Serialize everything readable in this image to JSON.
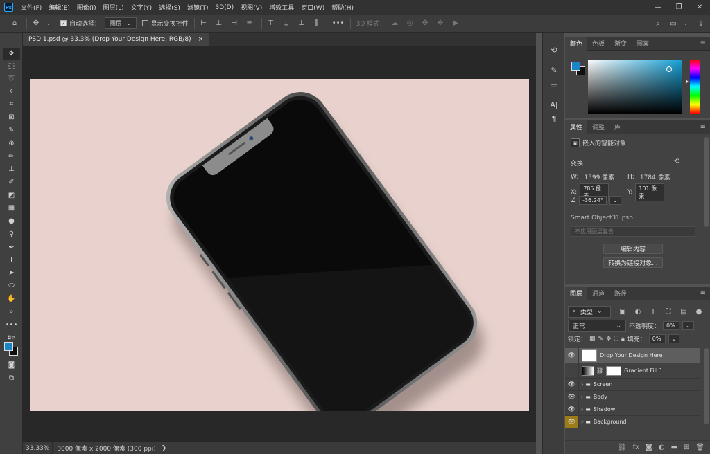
{
  "app": {
    "logo": "Ps"
  },
  "menu": [
    "文件(F)",
    "编辑(E)",
    "图像(I)",
    "图层(L)",
    "文字(Y)",
    "选择(S)",
    "滤镜(T)",
    "3D(D)",
    "视图(V)",
    "增效工具",
    "窗口(W)",
    "帮助(H)"
  ],
  "window_controls": {
    "minimize": "—",
    "maximize": "❐",
    "close": "✕"
  },
  "options": {
    "auto_select_label": "自动选择：",
    "auto_select_value": "图层",
    "show_transform_label": "显示变换控件",
    "more": "•••",
    "mode_3d_label": "3D 模式："
  },
  "document": {
    "tab_title": "PSD 1.psd @ 33.3% (Drop Your Design Here, RGB/8)",
    "tab_close": "×",
    "zoom": "33.33%",
    "size_info": "3000 像素 x 2000 像素 (300 ppi)",
    "status_arrow": "❯"
  },
  "colors": {
    "canvas_bg": "#e9d2cd",
    "accent_fg": "#1a86c7",
    "gold_eye": "#9c7c18"
  },
  "color_panel": {
    "tabs": [
      "颜色",
      "色板",
      "渐变",
      "图案"
    ]
  },
  "properties": {
    "tabs": [
      "属性",
      "调整",
      "库"
    ],
    "type": "嵌入的智能对象",
    "section": "变换",
    "w_label": "W:",
    "w_value": "1599 像素",
    "h_label": "H:",
    "h_value": "1784 像素",
    "x_label": "X:",
    "x_value": "785 像素",
    "y_label": "Y:",
    "y_value": "101 像素",
    "angle_value": "-36.24°",
    "smart_object_file": "Smart Object31.psb",
    "layer_comp_placeholder": "不应用图层复合",
    "edit_contents": "编辑内容",
    "convert_linked": "转换为链接对象..."
  },
  "layers": {
    "tabs": [
      "图层",
      "通道",
      "路径"
    ],
    "filter_kind": "类型",
    "blend_mode": "正常",
    "opacity_label": "不透明度：",
    "opacity_value": "0%",
    "lock_label": "锁定：",
    "fill_label": "填充：",
    "fill_value": "0%",
    "items": [
      {
        "name": "Drop Your Design Here",
        "selected": true,
        "visible": true
      },
      {
        "name": "Gradient Fill 1",
        "selected": false,
        "visible": false
      },
      {
        "name": "Screen",
        "selected": false,
        "visible": true
      },
      {
        "name": "Body",
        "selected": false,
        "visible": true
      },
      {
        "name": "Shadow",
        "selected": false,
        "visible": true
      },
      {
        "name": "Background",
        "selected": false,
        "visible": true
      }
    ]
  }
}
